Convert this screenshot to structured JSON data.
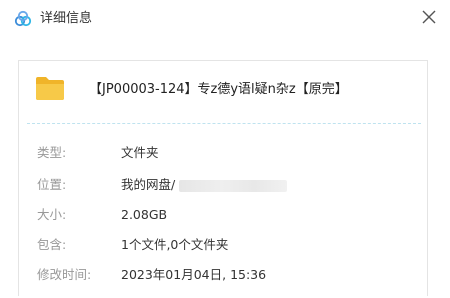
{
  "window": {
    "title": "详细信息",
    "app_icon": "baidu-netdisk-icon",
    "close_icon": "close-icon"
  },
  "file": {
    "icon": "folder-icon",
    "name": "【JP00003-124】专z德y语l疑n杂z【原完】"
  },
  "details": {
    "type_label": "类型:",
    "type_value": "文件夹",
    "location_label": "位置:",
    "location_value": "我的网盘/",
    "size_label": "大小:",
    "size_value": "2.08GB",
    "contains_label": "包含:",
    "contains_value": "1个文件,0个文件夹",
    "modified_label": "修改时间:",
    "modified_value": "2023年01月04日, 15:36"
  },
  "colors": {
    "accent": "#3b8cd9",
    "folder": "#f5c342",
    "label": "#999999",
    "value": "#333333",
    "divider": "#bfe3ef"
  }
}
